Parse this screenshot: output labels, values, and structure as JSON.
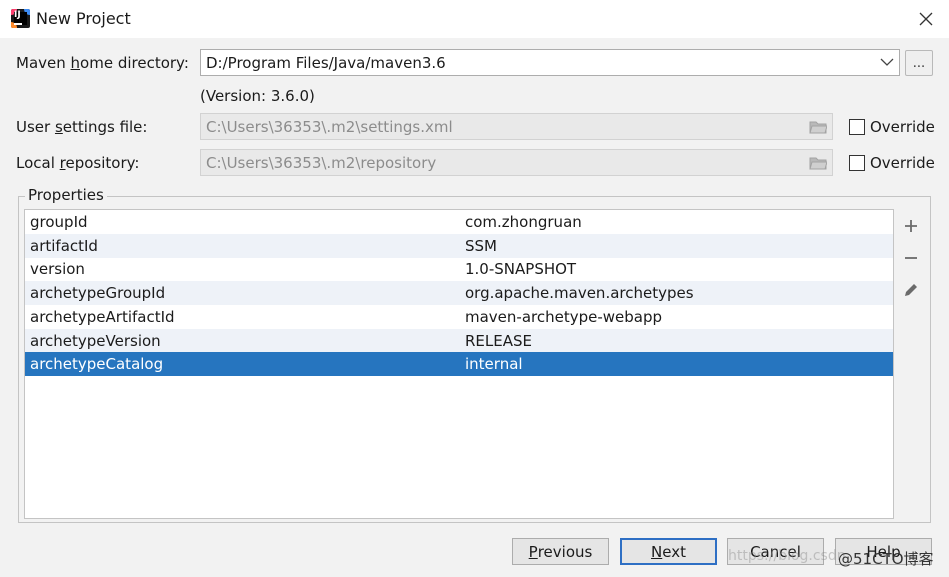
{
  "window": {
    "title": "New Project",
    "icon": "intellij-idea-icon",
    "close_icon": "close-icon"
  },
  "maven": {
    "home_label_pre": "Maven ",
    "home_label_u": "h",
    "home_label_post": "ome directory:",
    "home_value": "D:/Program Files/Java/maven3.6",
    "browse_label": "...",
    "version_text": "(Version: 3.6.0)",
    "settings_label_pre": "User ",
    "settings_label_u": "s",
    "settings_label_post": "ettings file:",
    "settings_value": "C:\\Users\\36353\\.m2\\settings.xml",
    "repo_label_pre": "Local ",
    "repo_label_u": "r",
    "repo_label_post": "epository:",
    "repo_value": "C:\\Users\\36353\\.m2\\repository",
    "override_label": "Override",
    "settings_override_checked": false,
    "repo_override_checked": false
  },
  "properties": {
    "title": "Properties",
    "rows": [
      {
        "key": "groupId",
        "value": "com.zhongruan"
      },
      {
        "key": "artifactId",
        "value": "SSM"
      },
      {
        "key": "version",
        "value": "1.0-SNAPSHOT"
      },
      {
        "key": "archetypeGroupId",
        "value": "org.apache.maven.archetypes"
      },
      {
        "key": "archetypeArtifactId",
        "value": "maven-archetype-webapp"
      },
      {
        "key": "archetypeVersion",
        "value": "RELEASE"
      },
      {
        "key": "archetypeCatalog",
        "value": "internal"
      }
    ],
    "selected_index": 6,
    "tools": [
      "plus-icon",
      "minus-icon",
      "pencil-icon"
    ]
  },
  "buttons": {
    "previous_u": "P",
    "previous_rest": "revious",
    "next_u": "N",
    "next_rest": "ext",
    "cancel": "Cancel",
    "help": "Help"
  },
  "watermark": {
    "url_text": "https://blog.csdn",
    "brand_text": "@51CTO博客"
  },
  "colors": {
    "selection": "#2675bf",
    "default_button_border": "#2e6fc4",
    "stripe": "#eef2f8"
  }
}
